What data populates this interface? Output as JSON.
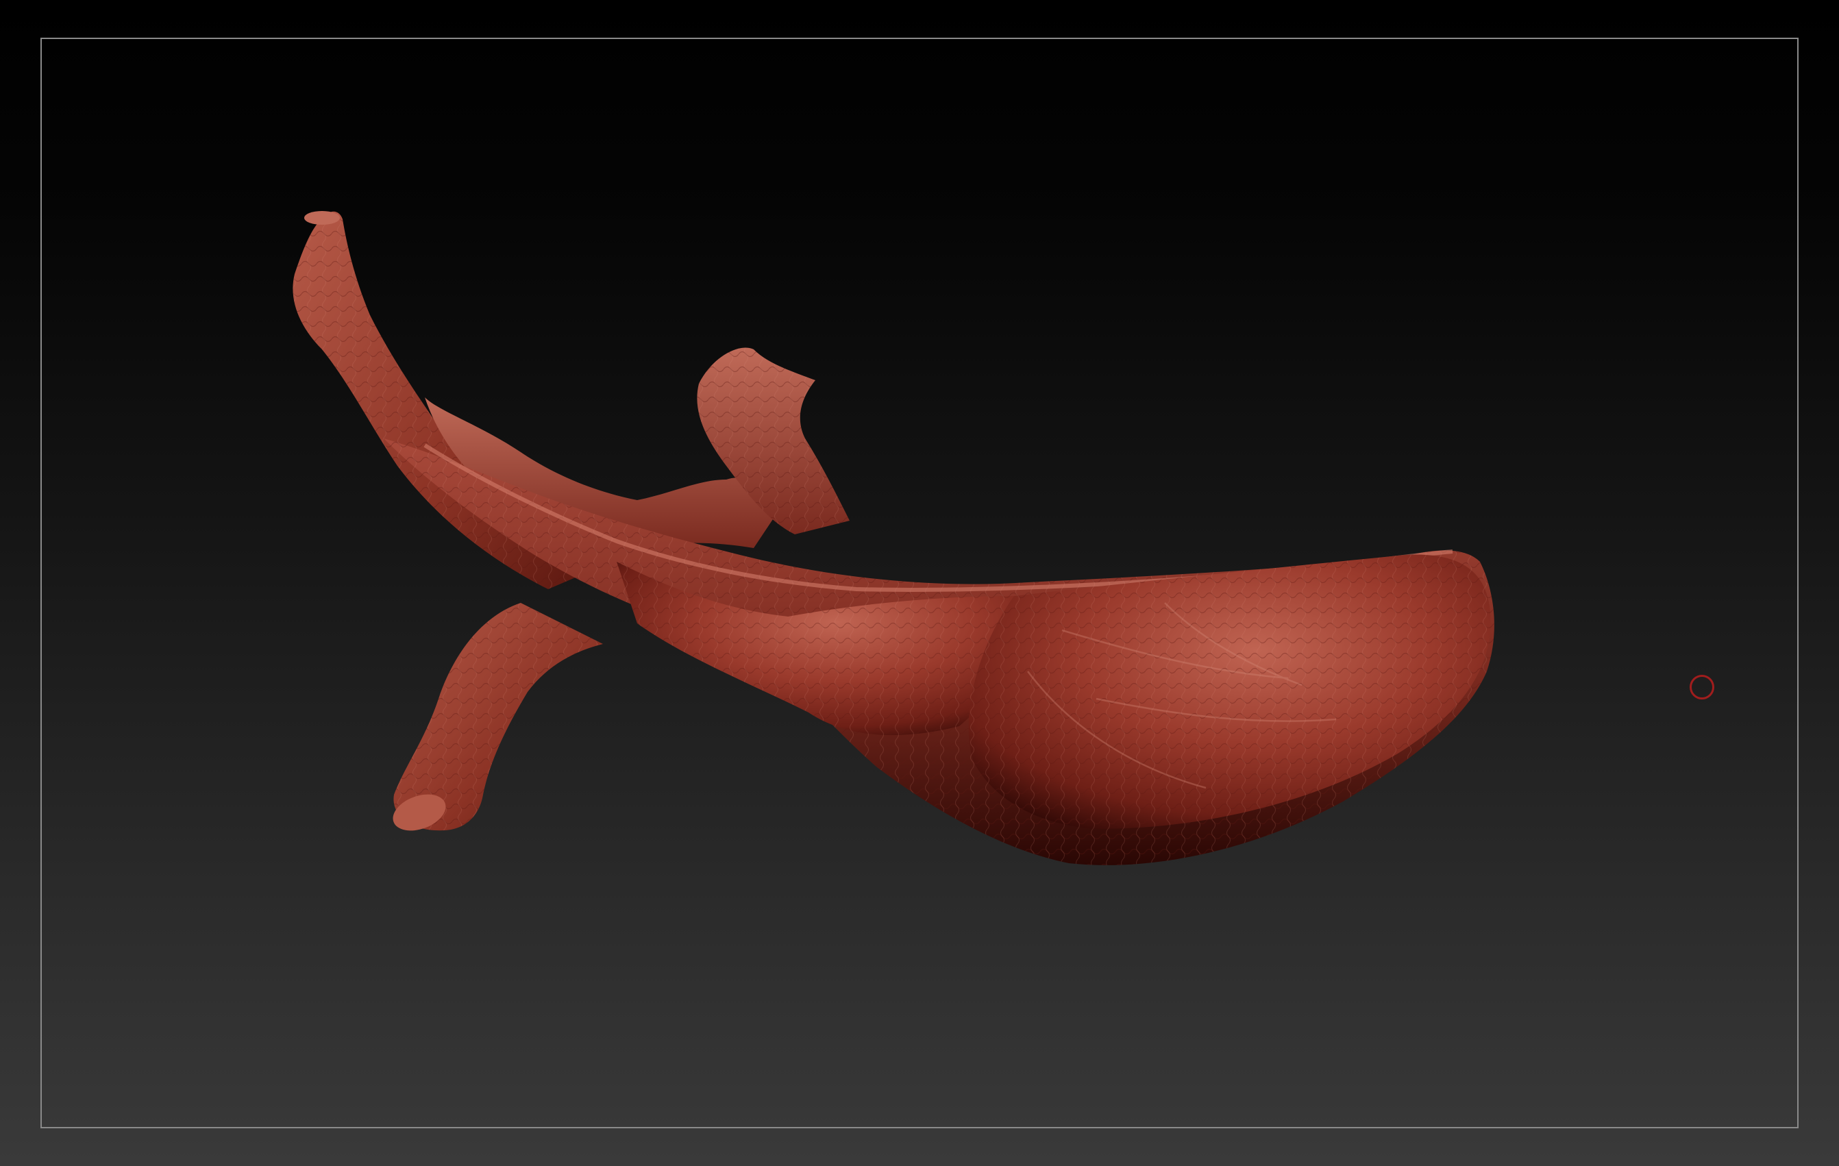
{
  "viewport": {
    "background_top": "#000000",
    "background_bottom": "#3a3a3a",
    "frame_color": "#8a8a8a"
  },
  "model": {
    "material_color": "#9a3a2c",
    "shadow_color": "#3a0d08",
    "highlight_color": "#c9705e"
  },
  "cursor": {
    "color": "#a11d1d",
    "shape": "circle-brush-icon"
  }
}
